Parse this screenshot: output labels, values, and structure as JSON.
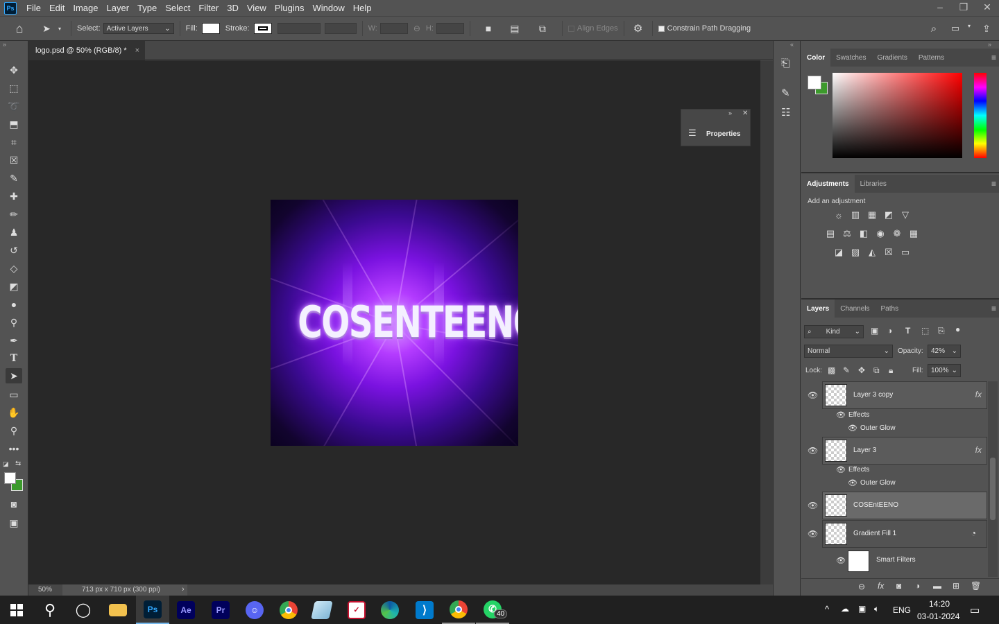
{
  "menu": {
    "items": [
      "File",
      "Edit",
      "Image",
      "Layer",
      "Type",
      "Select",
      "Filter",
      "3D",
      "View",
      "Plugins",
      "Window",
      "Help"
    ]
  },
  "window_controls": {
    "minimize": "–",
    "restore": "❐",
    "close": "✕"
  },
  "options_bar": {
    "select_label": "Select:",
    "select_value": "Active Layers",
    "fill_label": "Fill:",
    "stroke_label": "Stroke:",
    "w_label": "W:",
    "h_label": "H:",
    "align_edges_label": "Align Edges",
    "constrain_label": "Constrain Path Dragging"
  },
  "document": {
    "tab_title": "logo.psd @ 50% (RGB/8) *",
    "tab_close": "×",
    "zoom": "50%",
    "doc_info": "713 px x 710 px (300 ppi)",
    "artwork_text": "COSENTEENO"
  },
  "properties_float": {
    "label": "Properties"
  },
  "color_panel": {
    "tabs": [
      "Color",
      "Swatches",
      "Gradients",
      "Patterns"
    ],
    "foreground": "#ffffff",
    "background": "#3c9a2c"
  },
  "adjustments_panel": {
    "tabs": [
      "Adjustments",
      "Libraries"
    ],
    "hint": "Add an adjustment"
  },
  "layers_panel": {
    "tabs": [
      "Layers",
      "Channels",
      "Paths"
    ],
    "filter_kind": "Kind",
    "blend_mode": "Normal",
    "opacity_label": "Opacity:",
    "opacity_value": "42%",
    "lock_label": "Lock:",
    "fill_label": "Fill:",
    "fill_value": "100%",
    "layers": [
      {
        "name": "Layer 3 copy",
        "effects_label": "Effects",
        "effect": "Outer Glow"
      },
      {
        "name": "Layer 3",
        "effects_label": "Effects",
        "effect": "Outer Glow"
      },
      {
        "name": "COSEntEENO"
      },
      {
        "name": "Gradient Fill 1",
        "smart_filters": "Smart Filters"
      }
    ]
  },
  "taskbar": {
    "apps": [
      "Photoshop",
      "After Effects",
      "Premiere",
      "Discord",
      "Chrome",
      "Notes",
      "Vector",
      "Edge",
      "VS Code",
      "Chrome Profile",
      "WhatsApp"
    ],
    "whatsapp_badge": "40",
    "language": "ENG",
    "time": "14:20",
    "date": "03-01-2024"
  }
}
